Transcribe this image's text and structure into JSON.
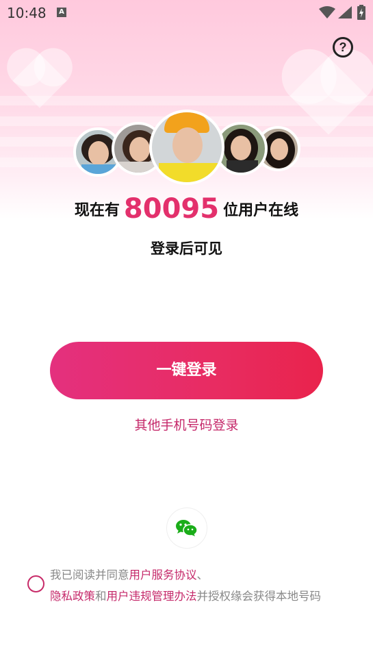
{
  "status_bar": {
    "time": "10:48",
    "notification_icon": "A",
    "icons": [
      "wifi-icon",
      "signal-icon",
      "battery-charging-icon"
    ]
  },
  "header": {
    "help_icon": "?"
  },
  "online": {
    "prefix": "现在有",
    "count": "80095",
    "suffix": "位用户在线",
    "subtitle": "登录后可见"
  },
  "actions": {
    "one_click_login": "一键登录",
    "other_phone_login": "其他手机号码登录",
    "wechat_login_icon": "wechat-icon"
  },
  "agreement": {
    "part1": "我已阅读并同意",
    "link1": "用户服务协议",
    "sep1": "、",
    "link2": "隐私政策",
    "part2": "和",
    "link3": "用户违规管理办法",
    "part3": "并授权缘会获得本地号码"
  },
  "colors": {
    "accent": "#e3306c",
    "link": "#c5296a",
    "button_gradient_start": "#e4307e",
    "button_gradient_end": "#e9234c"
  }
}
